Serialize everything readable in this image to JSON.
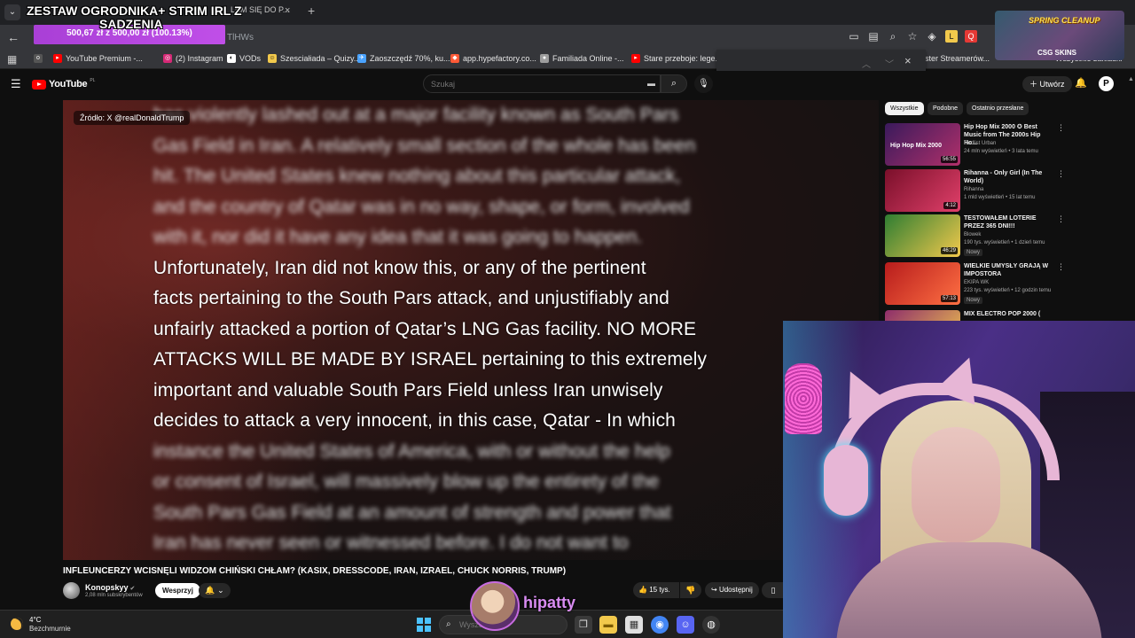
{
  "browser": {
    "tab_title": "LEM SIĘ DO P...",
    "url_fragment": "TlHWs",
    "bookmarks": [
      {
        "label": "YouTube Premium -...",
        "color": "#ff0000"
      },
      {
        "label": "(2) Instagram",
        "color": "#d62976"
      },
      {
        "label": "VODs",
        "color": "#ffffff"
      },
      {
        "label": "Szesciałiada – Quizy...",
        "color": "#f2c94c"
      },
      {
        "label": "Zaoszczędź 70%, ku...",
        "color": "#4aa3ff"
      },
      {
        "label": "app.hypefactory.co...",
        "color": "#ff5a36"
      },
      {
        "label": "Familiada Online -...",
        "color": "#9e9e9e"
      },
      {
        "label": "Stare przeboje: lege...",
        "color": "#ff0000"
      }
    ],
    "bookmark_more": "ster Streamerów...",
    "bookmark_all": "Wszystkie zakładki"
  },
  "overlay": {
    "title": "ZESTAW OGRODNIKA+ STRIM IRL Z",
    "subtitle": "SADZENIA",
    "progress_text": "500,67 zł z 500,00 zł (100.13%)",
    "progress_fraction": 1.0,
    "sponsor_title": "SPRING CLEANUP",
    "sponsor_logo": "CSG SKINS",
    "streamer_name": "hipatty"
  },
  "youtube": {
    "logo": "YouTube",
    "region": "PL",
    "search_placeholder": "Szukaj",
    "create_label": "Utwórz",
    "video": {
      "source": "Źródło: X @realDonaldTrump",
      "lines": [
        {
          "text": "has violently lashed out at a major facility known as South Pars",
          "blur": true
        },
        {
          "text": "Gas Field in Iran. A relatively small section of the whole has been",
          "blur": true
        },
        {
          "text": "hit. The United States knew nothing about this particular attack,",
          "blur": true
        },
        {
          "text": "and the country of Qatar was in no way, shape, or form, involved",
          "blur": true
        },
        {
          "text": "with it, nor did it have any idea that it was going to happen.",
          "blur": true
        },
        {
          "text": "Unfortunately, Iran did not know this, or any of the pertinent",
          "blur": false
        },
        {
          "text": "facts pertaining to the South Pars attack, and unjustifiably and",
          "blur": false
        },
        {
          "text": "unfairly attacked a portion of Qatar’s LNG Gas facility. NO MORE",
          "blur": false
        },
        {
          "text": "ATTACKS WILL BE MADE BY ISRAEL pertaining to this extremely",
          "blur": false
        },
        {
          "text": "important and valuable South Pars Field unless Iran unwisely",
          "blur": false
        },
        {
          "text": "decides to attack a very innocent, in this case, Qatar - In which",
          "blur": false
        },
        {
          "text": "instance the United States of America, with or without the help",
          "blur": true
        },
        {
          "text": "or consent of Israel, will massively blow up the entirety of the",
          "blur": true
        },
        {
          "text": "South Pars Gas Field at an amount of strength and power that",
          "blur": true
        },
        {
          "text": "Iran has never seen or witnessed before. I do not want to",
          "blur": true
        }
      ]
    },
    "title": "INFLEUNCERZY WCISNĘLI WIDZOM CHIŃSKI CHŁAM? (KASIX, DRESSCODE, IRAN, IZRAEL, CHUCK NORRIS, TRUMP)",
    "channel": {
      "name": "Konopskyy",
      "subs": "2,08 mln subskrybentów"
    },
    "support_label": "Wesprzyj",
    "likes": "15 tys.",
    "share_label": "Udostępnij",
    "chips": [
      "Wszystkie",
      "Podobne",
      "Ostatnio przesłane"
    ],
    "recommendations": [
      {
        "title": "Hip Hop Mix 2000 ✪ Best Music from The 2000s Hip Ho...",
        "channel": "Redlist Urban",
        "meta": "24 mln wyświetleń • 3 lata temu",
        "duration": "56:55",
        "thumb_label": "Hip Hop Mix 2000",
        "badge": "",
        "colors": [
          "#3a1a5c",
          "#b0306a"
        ]
      },
      {
        "title": "Rihanna - Only Girl (In The World)",
        "channel": "Rihanna",
        "meta": "1 mld wyświetleń • 15 lat temu",
        "duration": "4:12",
        "thumb_label": "",
        "badge": "",
        "colors": [
          "#7a0f2a",
          "#e0406a"
        ]
      },
      {
        "title": "TESTOWAŁEM LOTERIE PRZEZ 365 DNI!!!",
        "channel": "Blowek",
        "meta": "190 tys. wyświetleń • 1 dzień temu",
        "duration": "46:29",
        "thumb_label": "",
        "badge": "Nowy",
        "colors": [
          "#2e7d32",
          "#f2c94c"
        ]
      },
      {
        "title": "WIELKIE UMYSŁY GRAJĄ W IMPOSTORA",
        "channel": "EKIPA WK",
        "meta": "223 tys. wyświetleń • 12 godzin temu",
        "duration": "57:13",
        "thumb_label": "",
        "badge": "Nowy",
        "colors": [
          "#b71c1c",
          "#ff7043"
        ]
      },
      {
        "title": "MIX ELECTRO POP 2000 (",
        "channel": "",
        "meta": "",
        "duration": "",
        "thumb_label": "",
        "badge": "",
        "colors": [
          "#8e2d6b",
          "#f2c94c"
        ]
      }
    ]
  },
  "taskbar": {
    "temp": "4°C",
    "weather": "Bezchmurnie",
    "search_placeholder": "Wyszukaj"
  }
}
